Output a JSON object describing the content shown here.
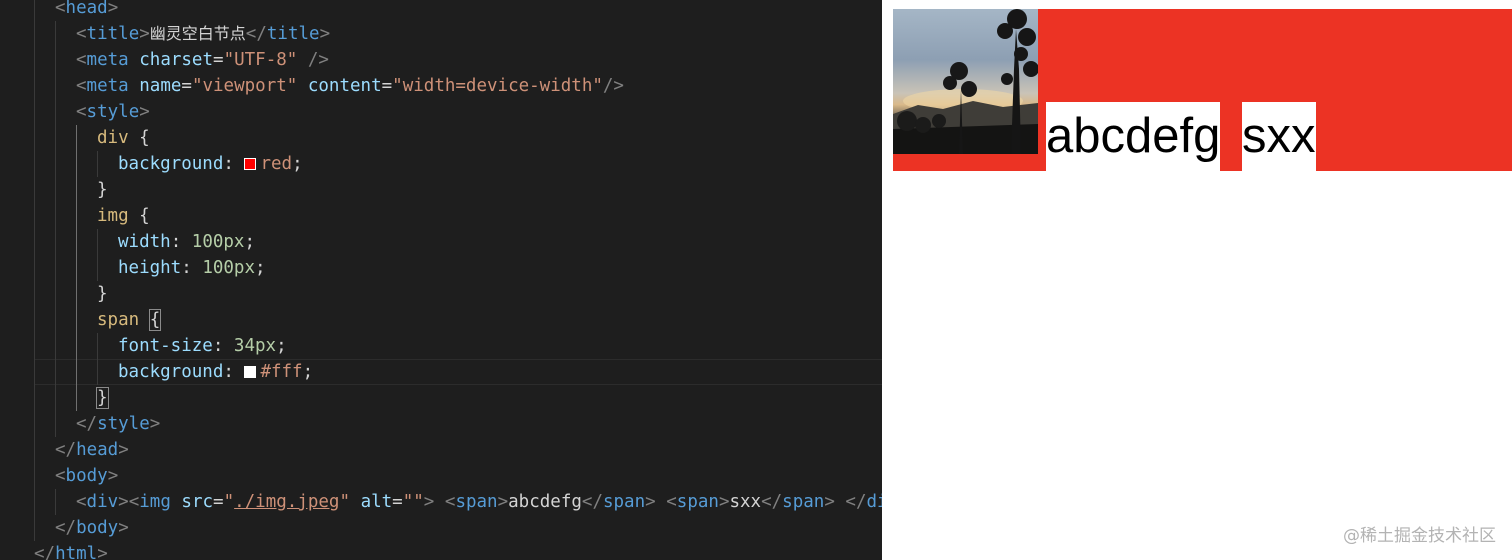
{
  "editor": {
    "lines": {
      "l01": {
        "open": "<",
        "tag": "head",
        "close": ">"
      },
      "l02": {
        "open": "<",
        "tag": "title",
        "close1": ">",
        "text": "幽灵空白节点",
        "open2": "</",
        "tag2": "title",
        "close2": ">"
      },
      "l03": {
        "open": "<",
        "tag": "meta",
        "attr": "charset",
        "eq": "=",
        "value": "\"UTF-8\"",
        "close": " />"
      },
      "l04": {
        "open": "<",
        "tag": "meta",
        "attr1": "name",
        "eq1": "=",
        "value1": "\"viewport\"",
        "attr2": "content",
        "eq2": "=",
        "value2": "\"width=device-width\"",
        "close": "/>"
      },
      "l05": {
        "open": "<",
        "tag": "style",
        "close": ">"
      },
      "l06": {
        "selector": "div",
        "brace": "{"
      },
      "l07": {
        "property": "background",
        "colon": ":",
        "value": "red",
        "semi": ";",
        "swatch_color": "#ff0000"
      },
      "l08": {
        "brace": "}"
      },
      "l09": {
        "selector": "img",
        "brace": "{"
      },
      "l10": {
        "property": "width",
        "colon": ":",
        "value": "100px",
        "semi": ";"
      },
      "l11": {
        "property": "height",
        "colon": ":",
        "value": "100px",
        "semi": ";"
      },
      "l12": {
        "brace": "}"
      },
      "l13": {
        "selector": "span",
        "brace": "{"
      },
      "l14": {
        "property": "font-size",
        "colon": ":",
        "value": "34px",
        "semi": ";"
      },
      "l15": {
        "property": "background",
        "colon": ":",
        "value": "#fff",
        "semi": ";",
        "swatch_color": "#ffffff"
      },
      "l16": {
        "brace": "}"
      },
      "l17": {
        "open": "</",
        "tag": "style",
        "close": ">"
      },
      "l18": {
        "open": "</",
        "tag": "head",
        "close": ">"
      },
      "l19": {
        "open": "<",
        "tag": "body",
        "close": ">"
      },
      "l20": {
        "div_open": "<",
        "div_tag": "div",
        "div_close": ">",
        "img_open": "<",
        "img_tag": "img",
        "src_attr": "src",
        "eq1": "=",
        "q1": "\"",
        "src_value": "./img.jpeg",
        "q2": "\"",
        "alt_attr": "alt",
        "eq2": "=",
        "alt_value": "\"\"",
        "img_close": ">",
        "span1_open": "<",
        "span1_tag": "span",
        "span1_close": ">",
        "span1_text": "abcdefg",
        "span1_end_open": "</",
        "span1_end_tag": "span",
        "span1_end_close": ">",
        "span2_open": "<",
        "span2_tag": "span",
        "span2_close": ">",
        "span2_text": "sxx",
        "span2_end_open": "</",
        "span2_end_tag": "span",
        "span2_end_close": ">",
        "enddiv_open": "</",
        "enddiv_tag": "di"
      },
      "l21": {
        "open": "</",
        "tag": "body",
        "close": ">"
      },
      "l22": {
        "open": "</",
        "tag": "html",
        "close": ">"
      }
    },
    "colors": {
      "background": "#1e1e1e",
      "tag": "#569cd6",
      "attribute": "#9cdcfe",
      "string": "#ce9178",
      "selector": "#d7ba7d",
      "number": "#b5cea8"
    }
  },
  "preview": {
    "div_background": "#ec3324",
    "span_background": "#ffffff",
    "span1_text": "abcdefg",
    "span2_text": "sxx",
    "watermark": "@稀土掘金技术社区"
  }
}
